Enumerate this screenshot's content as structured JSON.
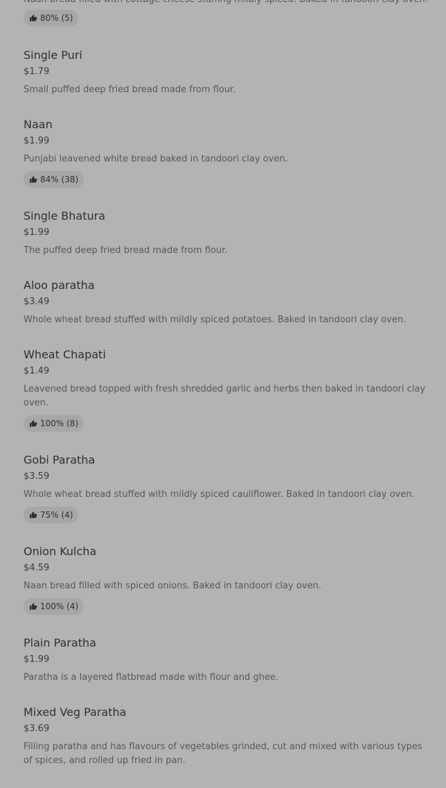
{
  "top_partial": {
    "description": "Naan bread filled with cottage cheese stuffing mildly spiced. Baked in tandoori clay oven.",
    "rating": "80% (5)"
  },
  "items": [
    {
      "name": "Single Puri",
      "price": "$1.79",
      "description": "Small puffed deep fried bread made from flour.",
      "rating": ""
    },
    {
      "name": "Naan",
      "price": "$1.99",
      "description": "Punjabi leavened white bread baked in tandoori clay oven.",
      "rating": "84% (38)"
    },
    {
      "name": "Single Bhatura",
      "price": "$1.99",
      "description": "The puffed deep fried bread made from flour.",
      "rating": ""
    },
    {
      "name": "Aloo paratha",
      "price": "$3.49",
      "description": "Whole wheat bread stuffed with mildly spiced potatoes. Baked in tandoori clay oven.",
      "rating": ""
    },
    {
      "name": "Wheat Chapati",
      "price": "$1.49",
      "description": "Leavened bread topped with fresh shredded garlic and herbs then baked in tandoori clay oven.",
      "rating": "100% (8)"
    },
    {
      "name": "Gobi Paratha",
      "price": "$3.59",
      "description": "Whole wheat bread stuffed with mildly spiced cauliflower. Baked in tandoori clay oven.",
      "rating": "75% (4)"
    },
    {
      "name": "Onion Kulcha",
      "price": "$4.59",
      "description": "Naan bread filled with spiced onions. Baked in tandoori clay oven.",
      "rating": "100% (4)"
    },
    {
      "name": "Plain Paratha",
      "price": "$1.99",
      "description": "Paratha is a layered flatbread made with flour and ghee.",
      "rating": ""
    },
    {
      "name": "Mixed Veg Paratha",
      "price": "$3.69",
      "description": "Filling paratha and has flavours of vegetables grinded, cut and mixed with various types of spices, and rolled up fried in pan.",
      "rating": ""
    }
  ]
}
